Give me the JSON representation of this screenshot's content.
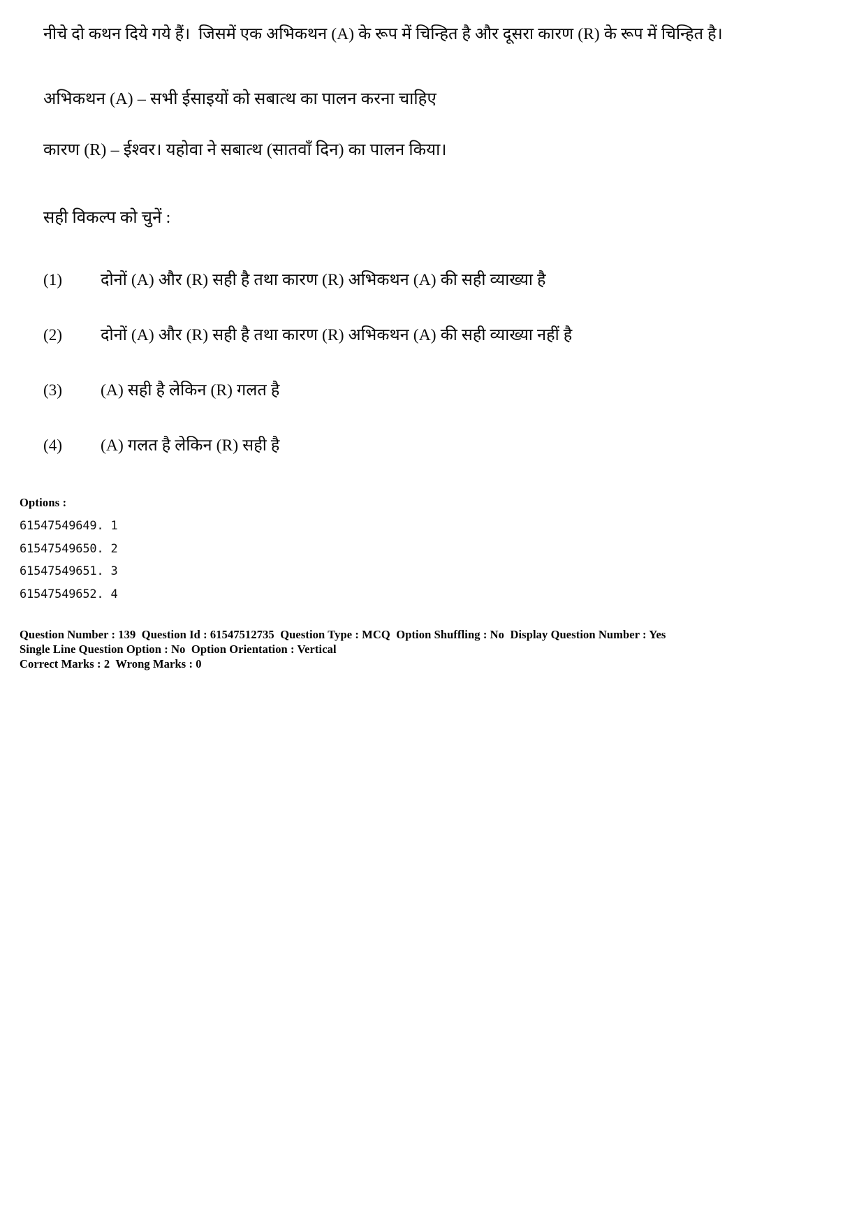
{
  "question": {
    "intro": "नीचे दो कथन दिये गये हैं।  जिसमें एक अभिकथन (A) के रूप में चिन्हित है और दूसरा कारण (R) के रूप में चिन्हित है।",
    "assertion": "अभिकथन (A) – सभी ईसाइयों को सबात्थ का पालन करना चाहिए",
    "reason": "कारण (R) – ईश्वर। यहोवा ने सबात्थ (सातवाँ दिन) का पालन किया।",
    "choose_prompt": "सही विकल्प को चुनें :"
  },
  "choices": [
    {
      "num": "(1)",
      "text": "दोनों (A) और (R) सही है तथा कारण (R) अभिकथन (A) की सही व्याख्या है"
    },
    {
      "num": "(2)",
      "text": "दोनों (A) और (R) सही है तथा कारण (R) अभिकथन (A) की सही व्याख्या नहीं है"
    },
    {
      "num": "(3)",
      "text": "(A) सही है लेकिन (R) गलत है"
    },
    {
      "num": "(4)",
      "text": "(A) गलत है लेकिन (R) सही है"
    }
  ],
  "options_meta": {
    "heading": "Options :",
    "ids": [
      "61547549649. 1",
      "61547549650. 2",
      "61547549651. 3",
      "61547549652. 4"
    ]
  },
  "question_meta": {
    "line1": "Question Number : 139  Question Id : 61547512735  Question Type : MCQ  Option Shuffling : No  Display Question Number : Yes",
    "line2": "Single Line Question Option : No  Option Orientation : Vertical",
    "line3": "Correct Marks : 2  Wrong Marks : 0"
  }
}
